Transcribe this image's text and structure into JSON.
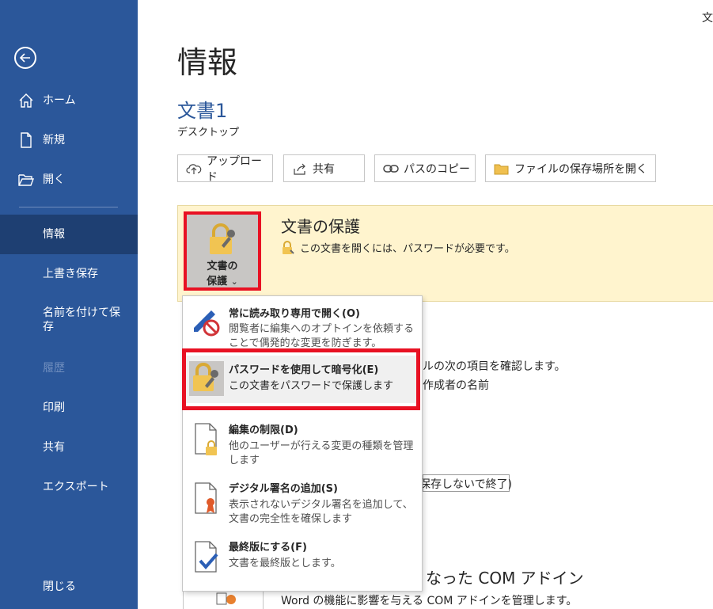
{
  "window": {
    "top_right_text": "文"
  },
  "sidebar": {
    "back_label": "",
    "items": [
      {
        "label": "ホーム",
        "icon": "home-icon"
      },
      {
        "label": "新規",
        "icon": "new-document-icon"
      },
      {
        "label": "開く",
        "icon": "folder-open-icon"
      },
      {
        "label": "情報"
      },
      {
        "label": "上書き保存"
      },
      {
        "label": "名前を付けて保\n存"
      },
      {
        "label": "履歴"
      },
      {
        "label": "印刷"
      },
      {
        "label": "共有"
      },
      {
        "label": "エクスポート"
      },
      {
        "label": "閉じる"
      }
    ]
  },
  "main": {
    "title": "情報",
    "doc_name": "文書1",
    "doc_location": "デスクトップ",
    "toolbar": {
      "upload": "アップロード",
      "share": "共有",
      "copy_path": "パスのコピー",
      "open_location": "ファイルの保存場所を開く"
    },
    "protect": {
      "button_line1": "文書の",
      "button_line2": "保護",
      "chevron": "⌄",
      "title": "文書の保護",
      "description": "この文書を開くには、パスワードが必要です。"
    },
    "background": {
      "inspect_partial": "ルの次の項目を確認します。",
      "author_partial": "作成者の名前",
      "exit_partial": "保存しないで終了)",
      "com_title_partial": "なった COM アドイン",
      "com_desc": "Word の機能に影響を与える COM アドインを管理します。"
    }
  },
  "dropdown": {
    "items": [
      {
        "title": "常に読み取り専用で開く(O)",
        "desc": "閲覧者に編集へのオプトインを依頼することで偶発的な変更を防ぎます。"
      },
      {
        "title": "パスワードを使用して暗号化(E)",
        "desc": "この文書をパスワードで保護します"
      },
      {
        "title": "編集の制限(D)",
        "desc": "他のユーザーが行える変更の種類を管理します"
      },
      {
        "title": "デジタル署名の追加(S)",
        "desc": "表示されないデジタル署名を追加して、文書の完全性を確保します"
      },
      {
        "title": "最終版にする(F)",
        "desc": "文書を最終版とします。"
      }
    ]
  },
  "colors": {
    "sidebar": "#2b579a",
    "sidebar_active": "#1e3f72",
    "highlight": "#e81123",
    "info_panel": "#fff4ce"
  }
}
